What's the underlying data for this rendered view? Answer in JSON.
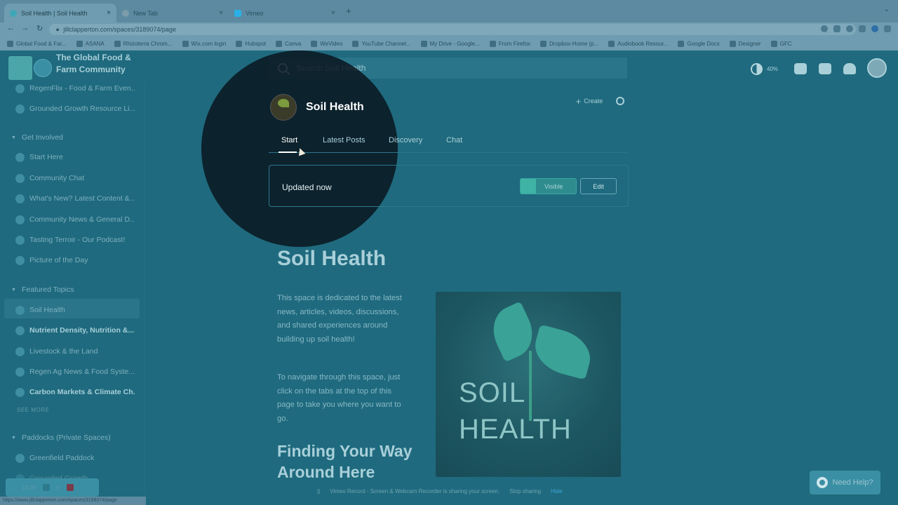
{
  "browser": {
    "tabs": [
      {
        "title": "Soil Health | Soil Health",
        "color": "#3fa6b8"
      },
      {
        "title": "New Tab",
        "color": "#7a9cab"
      },
      {
        "title": "Vimeo",
        "color": "#2ab0e6"
      }
    ],
    "new_tab": "+",
    "close": "×",
    "address": "jillclapperton.com/spaces/3189074/page",
    "status_url": "https://www.jillclapperton.com/spaces/3189074/page",
    "bookmarks": [
      "Global Food & Far...",
      "ASANA",
      "Rhizoterra Chrom...",
      "Wix.com login",
      "Hubspot",
      "Canva",
      "WeVideo",
      "YouTube Channel...",
      "My Drive - Google...",
      "From Firefox",
      "Dropbox-Home (p...",
      "Audiobook Resour...",
      "Google Docs",
      "Designer",
      "GFC"
    ]
  },
  "header": {
    "brand": "The Global Food & Farm Community",
    "search_placeholder": "Search Soil Health",
    "progress_label": "40%"
  },
  "sidebar": {
    "top_items": [
      "RegenFlix - Food & Farm Even...",
      "Grounded Growth Resource Li..."
    ],
    "sections": [
      {
        "label": "Get Involved",
        "items": [
          "Start Here",
          "Community Chat",
          "What's New? Latest Content &...",
          "Community News & General D...",
          "Tasting Terroir - Our Podcast!",
          "Picture of the Day"
        ]
      },
      {
        "label": "Featured Topics",
        "items": [
          "Soil Health",
          "Nutrient Density, Nutrition &...",
          "Livestock & the Land",
          "Regen Ag News & Food Syste...",
          "Carbon Markets & Climate Ch..."
        ]
      },
      {
        "label": "Paddocks (Private Spaces)",
        "items": [
          "Greenfield Paddock",
          "Grounded Growth"
        ]
      }
    ],
    "see_more": "SEE MORE"
  },
  "space": {
    "title": "Soil Health",
    "create_label": "Create",
    "tabs": [
      "Start",
      "Latest Posts",
      "Discovery",
      "Chat"
    ],
    "updated": "Updated now",
    "visible_label": "Visible",
    "edit_label": "Edit"
  },
  "content": {
    "heading": "Soil Health",
    "para1": "This space is dedicated to the latest news, articles, videos, discussions, and shared experiences around building up soil health!",
    "para2": "To navigate through this space, just click on the tabs at the top of this page to take you where you want to go.",
    "heading2": "Finding Your Way Around Here",
    "hero_line1": "SOIL",
    "hero_line2": "HEALTH"
  },
  "overlay": {
    "help_label": "Need Help?",
    "share_text": "Vimeo Record - Screen & Webcam Recorder is sharing your screen.",
    "stop_sharing": "Stop sharing",
    "hide": "Hide",
    "recorder_time": "13:26",
    "pause_symbol": "||"
  }
}
